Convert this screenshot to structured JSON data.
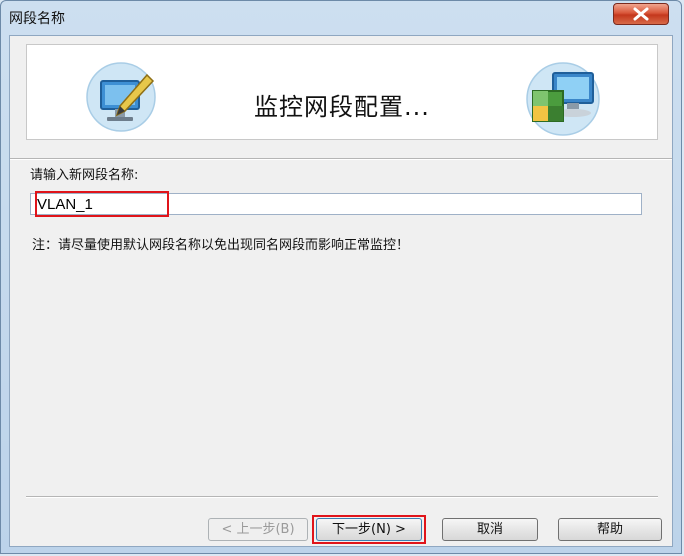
{
  "window": {
    "title": "网段名称",
    "close_icon": "close-icon"
  },
  "banner": {
    "title": "监控网段配置...",
    "left_icon": "monitor-edit-icon",
    "right_icon": "network-computers-icon"
  },
  "form": {
    "label": "请输入新网段名称:",
    "segment_name_value": "VLAN_1",
    "note": "注：请尽量使用默认网段名称以免出现同名网段而影响正常监控！"
  },
  "buttons": {
    "prev_label": "< 上一步(B)",
    "next_label": "下一步(N) >",
    "cancel_label": "取消",
    "help_label": "帮助"
  },
  "colors": {
    "highlight": "#e0141a",
    "close_button": "#c4371c",
    "frame": "#bcd3ea"
  }
}
